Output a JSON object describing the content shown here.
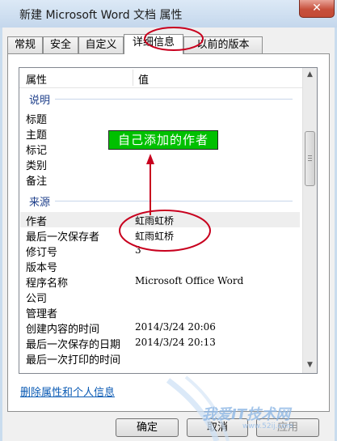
{
  "window": {
    "title": "新建 Microsoft Word 文档 属性",
    "close_glyph": "✕"
  },
  "tabs": [
    {
      "label": "常规"
    },
    {
      "label": "安全"
    },
    {
      "label": "自定义"
    },
    {
      "label": "详细信息"
    },
    {
      "label": "以前的版本"
    }
  ],
  "list": {
    "header": {
      "property": "属性",
      "value": "值"
    },
    "sections": [
      {
        "label": "说明"
      },
      {
        "label": "来源"
      }
    ],
    "rows": [
      {
        "name": "标题",
        "value": ""
      },
      {
        "name": "主题",
        "value": ""
      },
      {
        "name": "标记",
        "value": ""
      },
      {
        "name": "类别",
        "value": ""
      },
      {
        "name": "备注",
        "value": ""
      },
      {
        "name": "作者",
        "value": "虹雨虹桥"
      },
      {
        "name": "最后一次保存者",
        "value": "虹雨虹桥"
      },
      {
        "name": "修订号",
        "value": "3"
      },
      {
        "name": "版本号",
        "value": ""
      },
      {
        "name": "程序名称",
        "value": "Microsoft Office Word"
      },
      {
        "name": "公司",
        "value": ""
      },
      {
        "name": "管理者",
        "value": ""
      },
      {
        "name": "创建内容的时间",
        "value": "2014/3/24 20:06"
      },
      {
        "name": "最后一次保存的日期",
        "value": "2014/3/24 20:13"
      },
      {
        "name": "最后一次打印的时间",
        "value": ""
      }
    ]
  },
  "scrollbar": {
    "up": "▲",
    "down": "▼"
  },
  "remove_link": "删除属性和个人信息",
  "buttons": {
    "ok": "确定",
    "cancel": "取消",
    "apply": "应用"
  },
  "annotation": {
    "callout": "自己添加的作者",
    "color": "#00c000",
    "ink": "#c8001e"
  },
  "watermark": {
    "text": "我爱IT技术网",
    "url": "www.52ij.com"
  }
}
